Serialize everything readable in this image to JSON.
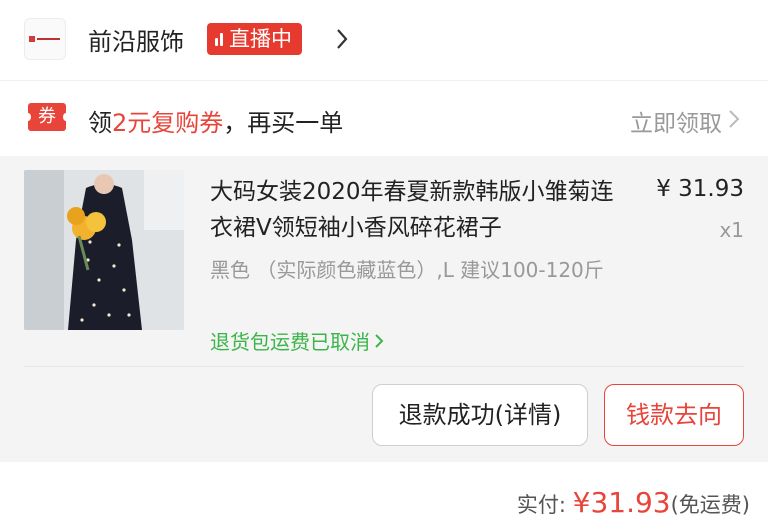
{
  "shop": {
    "logo_icon": "store-logo-icon",
    "name": "前沿服饰",
    "live_label": "直播中"
  },
  "coupon": {
    "tag": "券",
    "text_prefix": "领",
    "text_highlight": "2元复购券",
    "text_suffix": "，再买一单",
    "claim_label": "立即领取"
  },
  "product": {
    "title": "大码女装2020年春夏新款韩版小雏菊连衣裙V领短袖小香风碎花裙子",
    "price": "¥ 31.93",
    "qty": "x1",
    "sku": "黑色 （实际颜色藏蓝色）,L 建议100-120斤",
    "return_note": "退货包运费已取消"
  },
  "actions": {
    "refund_label": "退款成功(详情)",
    "money_label": "钱款去向"
  },
  "summary": {
    "paid_label": "实付: ",
    "paid_amount": "¥31.93",
    "shipping": "(免运费)"
  },
  "colors": {
    "accent_red": "#e8453a",
    "live_red": "#e63a2e",
    "green": "#3bb54a",
    "muted": "#999999"
  }
}
